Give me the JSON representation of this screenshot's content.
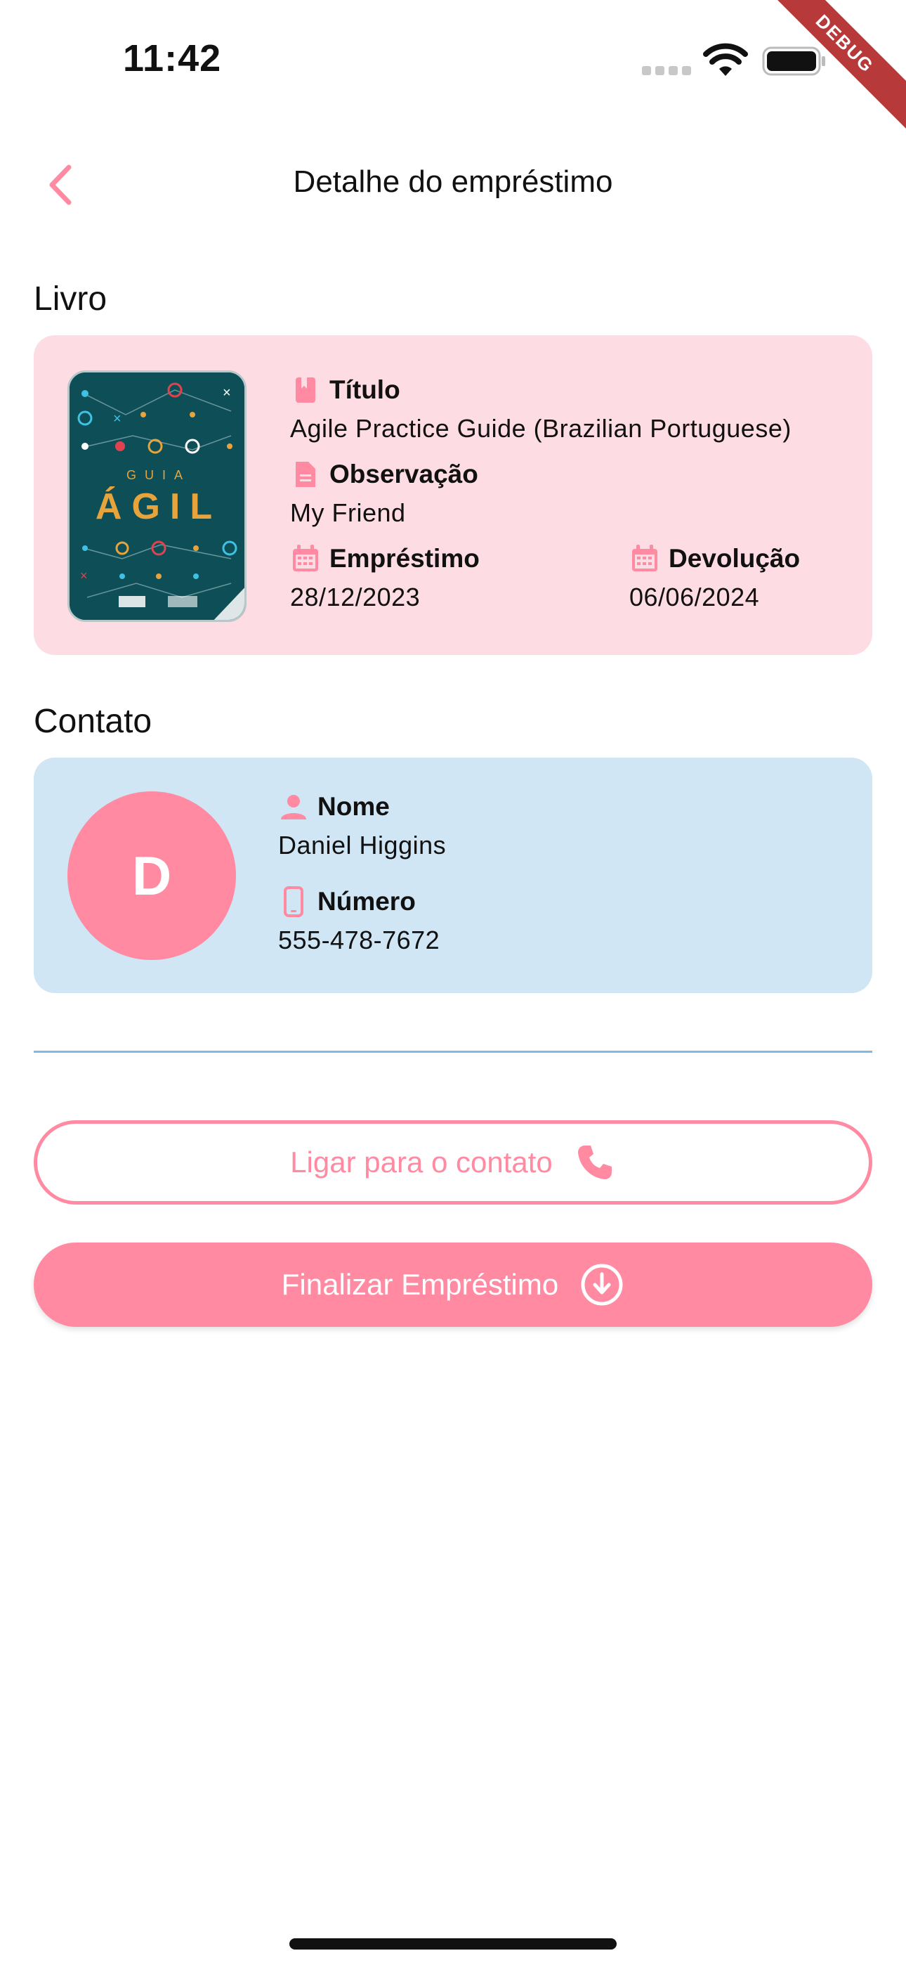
{
  "status_bar": {
    "time": "11:42",
    "debug_label": "DEBUG"
  },
  "app_bar": {
    "title": "Detalhe do empréstimo",
    "back_icon": "chevron-left-icon"
  },
  "book_section": {
    "title": "Livro",
    "cover": {
      "line1": "GUIA",
      "line2": "ÁGIL"
    },
    "fields": {
      "title": {
        "label": "Título",
        "value": "Agile Practice Guide (Brazilian Portuguese)",
        "icon": "bookmark-icon"
      },
      "note": {
        "label": "Observação",
        "value": "My Friend",
        "icon": "document-icon"
      },
      "loan_date": {
        "label": "Empréstimo",
        "value": "28/12/2023",
        "icon": "calendar-icon"
      },
      "return_date": {
        "label": "Devolução",
        "value": "06/06/2024",
        "icon": "calendar-icon"
      }
    }
  },
  "contact_section": {
    "title": "Contato",
    "avatar_initial": "D",
    "fields": {
      "name": {
        "label": "Nome",
        "value": "Daniel Higgins",
        "icon": "person-icon"
      },
      "number": {
        "label": "Número",
        "value": "555-478-7672",
        "icon": "phone-icon"
      }
    }
  },
  "actions": {
    "call_label": "Ligar para o contato",
    "finish_label": "Finalizar Empréstimo"
  },
  "colors": {
    "accent": "#ff8aa2",
    "book_card_bg": "#fddde3",
    "contact_card_bg": "#d0e6f5",
    "divider": "#7fb9e6",
    "debug_ribbon": "#b8393a"
  }
}
